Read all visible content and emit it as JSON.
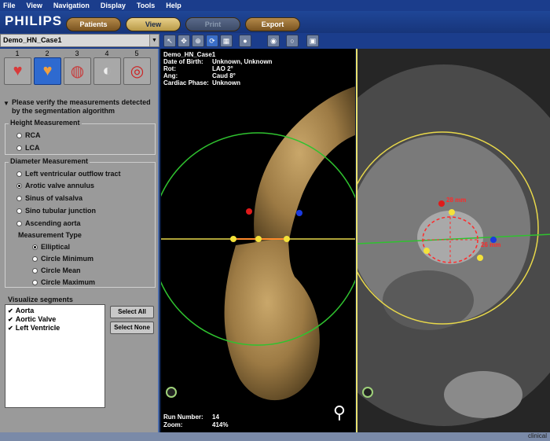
{
  "menu": [
    "File",
    "View",
    "Navigation",
    "Display",
    "Tools",
    "Help"
  ],
  "brand": "PHILIPS",
  "tabs": [
    {
      "label": "Patients",
      "state": "normal"
    },
    {
      "label": "View",
      "state": "active"
    },
    {
      "label": "Print",
      "state": "disabled"
    },
    {
      "label": "Export",
      "state": "normal"
    }
  ],
  "case_select": {
    "value": "Demo_HN_Case1"
  },
  "steps": {
    "numbers": [
      "1",
      "2",
      "3",
      "4",
      "5"
    ],
    "active_index": 1
  },
  "instructions": "Please verify the measurements detected by the segmentation algorithm",
  "height_measurement": {
    "title": "Height Measurement",
    "options": [
      "RCA",
      "LCA"
    ]
  },
  "diameter_measurement": {
    "title": "Diameter Measurement",
    "options": [
      "Left ventricular outflow tract",
      "Arotic valve annulus",
      "Sinus of valsalva",
      "Sino tubular junction",
      "Ascending aorta"
    ],
    "selected_index": 1,
    "type_title": "Measurement Type",
    "types": [
      "Elliptical",
      "Circle Minimum",
      "Circle Mean",
      "Circle Maximum"
    ],
    "selected_type_index": 0
  },
  "visualize": {
    "title": "Visualize segments",
    "items": [
      "Aorta",
      "Aortic Valve",
      "Left Ventricle"
    ],
    "checked": [
      true,
      true,
      true
    ],
    "select_all": "Select All",
    "select_none": "Select None"
  },
  "viewport_info": {
    "case": "Demo_HN_Case1",
    "rows": [
      {
        "k": "Date of Birth:",
        "v": "Unknown, Unknown"
      },
      {
        "k": "Rot:",
        "v": "LAO  2°"
      },
      {
        "k": "Ang:",
        "v": "Caud  8°"
      },
      {
        "k": "Cardiac Phase:",
        "v": "Unknown"
      }
    ],
    "run_number_label": "Run Number:",
    "run_number": "14",
    "zoom_label": "Zoom:",
    "zoom": "414%"
  },
  "ct_measurements": {
    "label_top": "28 mm",
    "label_right": "26 mm"
  },
  "status": {
    "clinical": "clinical"
  },
  "colors": {
    "accent": "#1b3d8c",
    "tab_gold": "#b89a48",
    "ring_green": "#2fc22f",
    "ring_yellow": "#e8d84a",
    "measure_red": "#ff2a2a"
  },
  "icons": {
    "toolbar": [
      "dropdown-icon",
      "pointer-icon",
      "pan-icon",
      "zoom-icon",
      "rotate-icon",
      "select-icon",
      "palette-icon",
      "record-icon",
      "sphere-icon",
      "camera-icon"
    ],
    "orientation": "body-orientation-icon"
  }
}
